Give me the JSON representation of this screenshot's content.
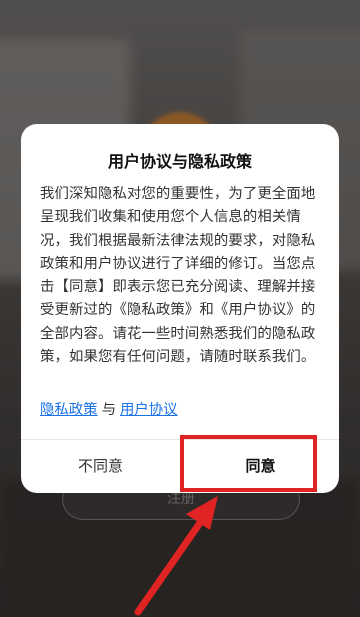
{
  "background": {
    "register_button_label": "注册"
  },
  "dialog": {
    "title": "用户协议与隐私政策",
    "body": "我们深知隐私对您的重要性，为了更全面地呈现我们收集和使用您个人信息的相关情况，我们根据最新法律法规的要求，对隐私政策和用户协议进行了详细的修订。当您点击【同意】即表示您已充分阅读、理解并接受更新过的《隐私政策》和《用户协议》的全部内容。请花一些时间熟悉我们的隐私政策，如果您有任何问题，请随时联系我们。",
    "privacy_link": "隐私政策",
    "and_text": "与",
    "user_agreement_link": "用户协议",
    "disagree_label": "不同意",
    "agree_label": "同意"
  },
  "colors": {
    "link": "#1a73e8",
    "highlight": "#e02424",
    "arrow": "#e02424"
  },
  "icons": {
    "annotation_arrow": "arrow-up-right-icon"
  }
}
